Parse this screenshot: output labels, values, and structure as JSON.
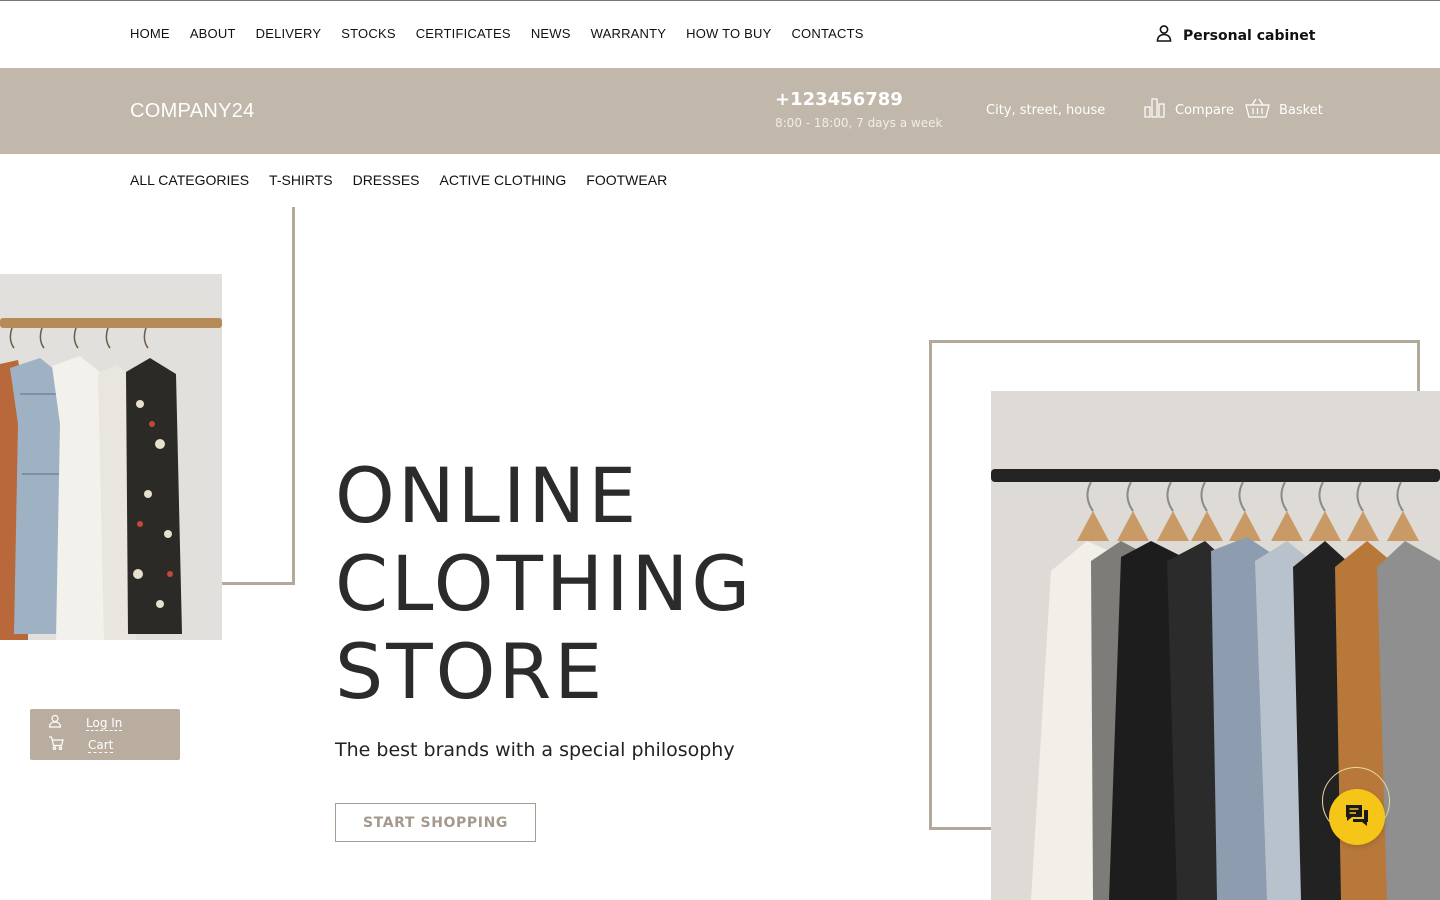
{
  "top_nav": {
    "items": [
      {
        "label": "HOME"
      },
      {
        "label": "ABOUT"
      },
      {
        "label": "DELIVERY"
      },
      {
        "label": "STOCKS"
      },
      {
        "label": "CERTIFICATES"
      },
      {
        "label": "NEWS"
      },
      {
        "label": "WARRANTY"
      },
      {
        "label": "HOW TO BUY"
      },
      {
        "label": "CONTACTS"
      }
    ],
    "personal_cabinet": {
      "label": "Personal cabinet",
      "icon": "user-icon"
    }
  },
  "header": {
    "logo": "COMPANY24",
    "phone": "+123456789",
    "hours": "8:00 - 18:00, 7 days a week",
    "address": "City, street, house",
    "compare": {
      "label": "Compare",
      "icon": "bar-chart-icon"
    },
    "basket": {
      "label": "Basket",
      "icon": "basket-icon"
    },
    "background_color": "#c1b7aa"
  },
  "category_nav": {
    "items": [
      {
        "label": "ALL CATEGORIES"
      },
      {
        "label": "T-SHIRTS"
      },
      {
        "label": "DRESSES"
      },
      {
        "label": "ACTIVE CLOTHING"
      },
      {
        "label": "FOOTWEAR"
      }
    ]
  },
  "hero": {
    "title_lines": [
      "ONLINE",
      "CLOTHING",
      "STORE"
    ],
    "subtitle": "The best brands with a special philosophy",
    "cta_label": "START SHOPPING",
    "accent_color": "#b3a99a"
  },
  "widget": {
    "login": {
      "label": "Log In",
      "icon": "user-icon"
    },
    "cart": {
      "label": "Cart",
      "icon": "cart-icon"
    }
  },
  "chat": {
    "icon": "chat-icon",
    "color": "#f5c518"
  }
}
